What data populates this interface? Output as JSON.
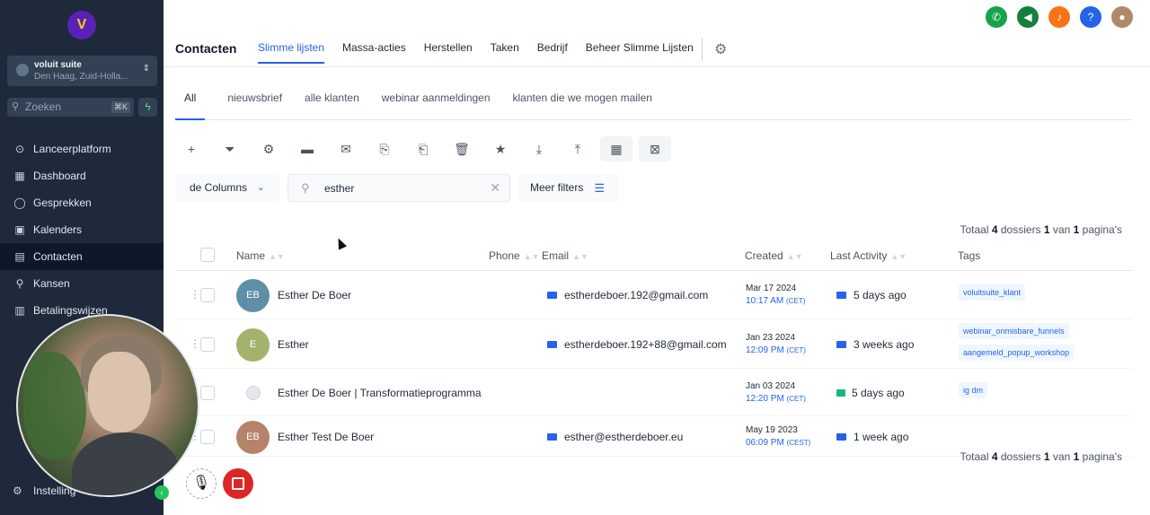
{
  "sidebar": {
    "logo_glyph": "V",
    "account": {
      "name": "voluit suite",
      "location": "Den Haag, Zuid-Holla...",
      "chevron": "⌃⌄"
    },
    "search": {
      "placeholder": "Zoeken",
      "shortcut": "⌘K"
    },
    "items": [
      {
        "label": "Lanceerplatform",
        "icon": "rocket-icon",
        "glyph": "⊙"
      },
      {
        "label": "Dashboard",
        "icon": "dashboard-icon",
        "glyph": "▦"
      },
      {
        "label": "Gesprekken",
        "icon": "chat-icon",
        "glyph": "◯"
      },
      {
        "label": "Kalenders",
        "icon": "calendar-icon",
        "glyph": "▣"
      },
      {
        "label": "Contacten",
        "icon": "contacts-icon",
        "glyph": "▤"
      },
      {
        "label": "Kansen",
        "icon": "opportunities-icon",
        "glyph": "⚲"
      },
      {
        "label": "Betalingswijzen",
        "icon": "payments-icon",
        "glyph": "▥"
      }
    ],
    "settings_label": "Instelling"
  },
  "header": {
    "title": "Contacten",
    "tabs": [
      "Slimme lijsten",
      "Massa-acties",
      "Herstellen",
      "Taken",
      "Bedrijf",
      "Beheer Slimme Lijsten"
    ],
    "icons": [
      {
        "name": "phone-icon",
        "glyph": "✆",
        "color": "#16a34a"
      },
      {
        "name": "megaphone-icon",
        "glyph": "◀",
        "color": "#15803d"
      },
      {
        "name": "bell-icon",
        "glyph": "♪",
        "color": "#f97316"
      },
      {
        "name": "help-icon",
        "glyph": "?",
        "color": "#2563eb"
      },
      {
        "name": "user-avatar-icon",
        "glyph": "●",
        "color": "#b08968"
      }
    ]
  },
  "subtabs": [
    "All",
    "nieuwsbrief",
    "alle klanten",
    "webinar aanmeldingen",
    "klanten die we mogen mailen"
  ],
  "toolbar": [
    {
      "name": "add-icon",
      "glyph": "+"
    },
    {
      "name": "filter-icon",
      "glyph": "⏷"
    },
    {
      "name": "robot-icon",
      "glyph": "⚙"
    },
    {
      "name": "message-icon",
      "glyph": "▬"
    },
    {
      "name": "email-icon",
      "glyph": "✉"
    },
    {
      "name": "copy-tag-icon",
      "glyph": "⎘"
    },
    {
      "name": "remove-tag-icon",
      "glyph": "⎗"
    },
    {
      "name": "delete-icon",
      "glyph": "🗑"
    },
    {
      "name": "star-icon",
      "glyph": "★"
    },
    {
      "name": "download-icon",
      "glyph": "⤓"
    },
    {
      "name": "upload-icon",
      "glyph": "⤒"
    },
    {
      "name": "company-icon",
      "glyph": "▦"
    },
    {
      "name": "merge-icon",
      "glyph": "⊠"
    }
  ],
  "filters": {
    "columns_label": "de Columns",
    "search_value": "esther",
    "more_filters_label": "Meer filters"
  },
  "totals": {
    "prefix": "Totaal",
    "count": "4",
    "mid": "dossiers",
    "page": "1",
    "of": "van",
    "pages": "1",
    "suffix": "pagina's"
  },
  "table": {
    "headers": {
      "name": "Name",
      "phone": "Phone",
      "email": "Email",
      "created": "Created",
      "last_activity": "Last Activity",
      "tags": "Tags"
    },
    "rows": [
      {
        "initials": "EB",
        "avatar_color": "#5f8fa8",
        "name": "Esther De Boer",
        "email": "estherdeboer.192@gmail.com",
        "created_date": "Mar 17 2024",
        "created_time": "10:17 AM",
        "tz": "(CET)",
        "activity": "5 days ago",
        "activity_type": "email",
        "tags": [
          "voluitsuite_klant"
        ]
      },
      {
        "initials": "E",
        "avatar_color": "#a3b36b",
        "name": "Esther",
        "email": "estherdeboer.192+88@gmail.com",
        "created_date": "Jan 23 2024",
        "created_time": "12:09 PM",
        "tz": "(CET)",
        "activity": "3 weeks ago",
        "activity_type": "email",
        "tags": [
          "webinar_onmisbare_funnels",
          "aangemeld_popup_workshop"
        ]
      },
      {
        "initials": "",
        "avatar_color": "#e5e7eb",
        "name": "Esther De Boer | Transformatieprogramma",
        "email": "",
        "created_date": "Jan 03 2024",
        "created_time": "12:20 PM",
        "tz": "(CET)",
        "activity": "5 days ago",
        "activity_type": "chat",
        "tags": [
          "ig dm"
        ]
      },
      {
        "initials": "EB",
        "avatar_color": "#b5836a",
        "name": "Esther Test De Boer",
        "email": "esther@estherdeboer.eu",
        "created_date": "May 19 2023",
        "created_time": "06:09 PM",
        "tz": "(CEST)",
        "activity": "1 week ago",
        "activity_type": "email",
        "tags": []
      }
    ]
  },
  "recording": {
    "mic_glyph": "🎙"
  }
}
